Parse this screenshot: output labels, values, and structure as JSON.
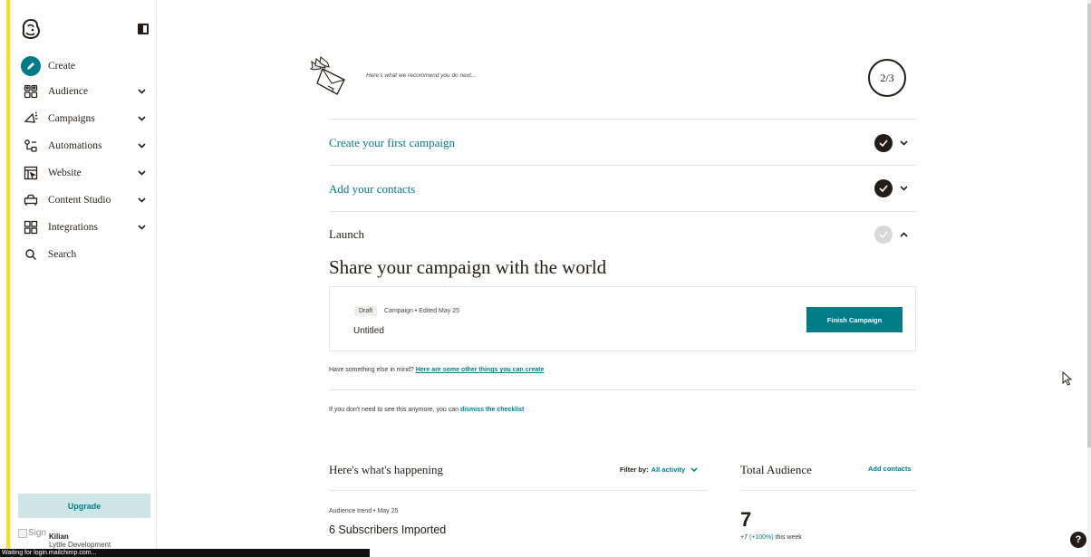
{
  "sidebar": {
    "items": [
      {
        "label": "Create",
        "icon": "pencil-icon",
        "expandable": false
      },
      {
        "label": "Audience",
        "icon": "audience-icon",
        "expandable": true
      },
      {
        "label": "Campaigns",
        "icon": "megaphone-icon",
        "expandable": true
      },
      {
        "label": "Automations",
        "icon": "automations-icon",
        "expandable": true
      },
      {
        "label": "Website",
        "icon": "website-icon",
        "expandable": true
      },
      {
        "label": "Content Studio",
        "icon": "content-studio-icon",
        "expandable": true
      },
      {
        "label": "Integrations",
        "icon": "integrations-icon",
        "expandable": true
      },
      {
        "label": "Search",
        "icon": "search-icon",
        "expandable": false
      }
    ],
    "upgrade_label": "Upgrade",
    "broken_image_alt": "Sign",
    "user_name": "Kilian",
    "user_org": "Lyttle Development"
  },
  "status_bar": "Waiting for login.mailchimp.com...",
  "checklist": {
    "recommend_text": "Here's what we recommend you do next...",
    "progress": "2/3",
    "steps": [
      {
        "label": "Create your first campaign",
        "done": true
      },
      {
        "label": "Add your contacts",
        "done": true
      },
      {
        "label": "Launch",
        "done": false
      }
    ],
    "launch_heading": "Share your campaign with the world",
    "draft": {
      "badge": "Draft",
      "meta": "Campaign • Edited May 25",
      "title": "Untitled",
      "button": "Finish Campaign"
    },
    "other_prefix": "Have something else in mind?",
    "other_link": "Here are some other things you can create",
    "dismiss_prefix": "If you don't need to see this anymore, you can",
    "dismiss_link": "dismiss the checklist"
  },
  "happening": {
    "title": "Here's what's happening",
    "filter_label": "Filter by:",
    "filter_value": "All activity",
    "trend_meta": "Audience trend • May 25",
    "trend_title": "6 Subscribers Imported"
  },
  "audience": {
    "title": "Total Audience",
    "add_contacts": "Add contacts",
    "count": "7",
    "week_prefix": "+7",
    "week_pct": "(+100%)",
    "week_suffix": "this week"
  },
  "help_label": "?",
  "colors": {
    "accent": "#007c89",
    "brand_yellow": "#ffe01b",
    "ink": "#241c15",
    "upgrade_bg": "#cfe6e9"
  }
}
